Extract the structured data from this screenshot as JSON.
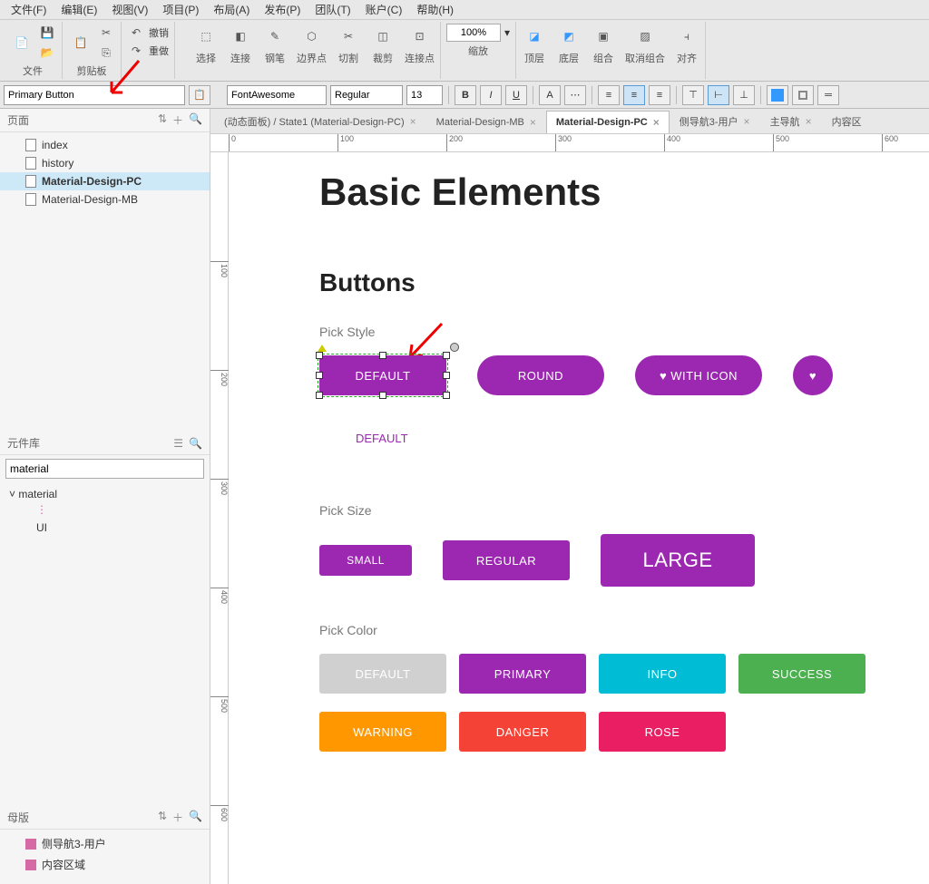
{
  "menu": [
    "文件(F)",
    "编辑(E)",
    "视图(V)",
    "项目(P)",
    "布局(A)",
    "发布(P)",
    "团队(T)",
    "账户(C)",
    "帮助(H)"
  ],
  "ribbon": {
    "file_label": "文件",
    "clipboard_label": "剪贴板",
    "undo": "撤销",
    "redo": "重做",
    "select": "选择",
    "connect": "连接",
    "pen": "钢笔",
    "boundary": "边界点",
    "cut": "切割",
    "crop": "裁剪",
    "connector": "连接点",
    "zoom_value": "100%",
    "zoom_label": "缩放",
    "top": "顶层",
    "bottom": "底层",
    "group": "组合",
    "ungroup": "取消组合",
    "align": "对齐"
  },
  "props": {
    "element_name": "Primary Button",
    "font": "FontAwesome",
    "weight": "Regular",
    "size": "13"
  },
  "leftpanel": {
    "pages_title": "页面",
    "pages": [
      "index",
      "history",
      "Material-Design-PC",
      "Material-Design-MB"
    ],
    "selected_page": "Material-Design-PC",
    "lib_title": "元件库",
    "lib_search": "material",
    "lib_root": "material",
    "lib_item": "UI",
    "masters_title": "母版",
    "masters": [
      "侧导航3-用户",
      "内容区域"
    ]
  },
  "tabs": [
    {
      "label": "(动态面板) / State1 (Material-Design-PC)",
      "active": false
    },
    {
      "label": "Material-Design-MB",
      "active": false
    },
    {
      "label": "Material-Design-PC",
      "active": true
    },
    {
      "label": "侧导航3-用户",
      "active": false
    },
    {
      "label": "主导航",
      "active": false
    },
    {
      "label": "内容区",
      "active": false
    }
  ],
  "ruler_ticks_h": [
    "0",
    "100",
    "200",
    "300",
    "400",
    "500",
    "600"
  ],
  "ruler_ticks_v": [
    "100",
    "200",
    "300",
    "400",
    "500",
    "600"
  ],
  "canvas": {
    "title": "Basic Elements",
    "section_buttons": "Buttons",
    "pick_style": "Pick Style",
    "btn_default": "DEFAULT",
    "btn_round": "ROUND",
    "btn_withicon": "WITH ICON",
    "text_default": "DEFAULT",
    "pick_size": "Pick  Size",
    "btn_small": "SMALL",
    "btn_regular": "REGULAR",
    "btn_large": "LARGE",
    "pick_color": "Pick  Color",
    "c_default": "DEFAULT",
    "c_primary": "PRIMARY",
    "c_info": "INFO",
    "c_success": "SUCCESS",
    "c_warning": "WARNING",
    "c_danger": "DANGER",
    "c_rose": "ROSE"
  }
}
